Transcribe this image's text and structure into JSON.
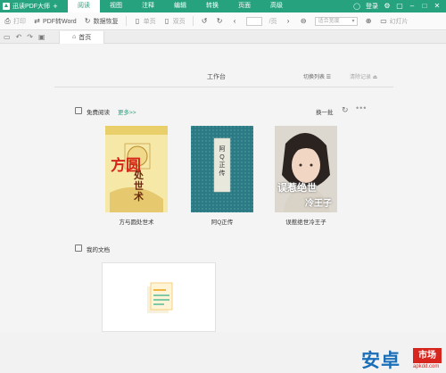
{
  "app": {
    "title": "迅读PDF大师",
    "new_tab": "+"
  },
  "menus": [
    {
      "label": "阅读",
      "active": true
    },
    {
      "label": "视图"
    },
    {
      "label": "注释"
    },
    {
      "label": "编辑"
    },
    {
      "label": "转换"
    },
    {
      "label": "页面"
    },
    {
      "label": "高级"
    }
  ],
  "window": {
    "login": "登录"
  },
  "toolbar": {
    "print": "打印",
    "pdf_to_word": "PDF转Word",
    "restore": "数据恢复",
    "single_page": "单页",
    "double_page": "双页",
    "page_sep": "/页",
    "zoom_placeholder": "适合宽度",
    "slideshow": "幻灯片"
  },
  "tab": {
    "home": "首页"
  },
  "workspace": {
    "title": "工作台",
    "switch_list": "切换列表",
    "clear_records": "清除记录"
  },
  "free_reading": {
    "title": "免费阅读",
    "more": "更多>>",
    "swap": "换一批",
    "books": [
      {
        "title": "方与圆处世术",
        "cover_title": "方圆",
        "cover_sub": "处世术"
      },
      {
        "title": "阿Q正传",
        "cover_title": "阿Q正传"
      },
      {
        "title": "误惹绝世冷王子",
        "cover_title": "误惹绝世",
        "cover_sub": "冷王子"
      }
    ]
  },
  "my_docs": {
    "title": "我的文档"
  },
  "watermark": {
    "brand": "安卓",
    "badge": "市场",
    "domain": "apkdd.com"
  },
  "colors": {
    "accent": "#26a37e"
  }
}
